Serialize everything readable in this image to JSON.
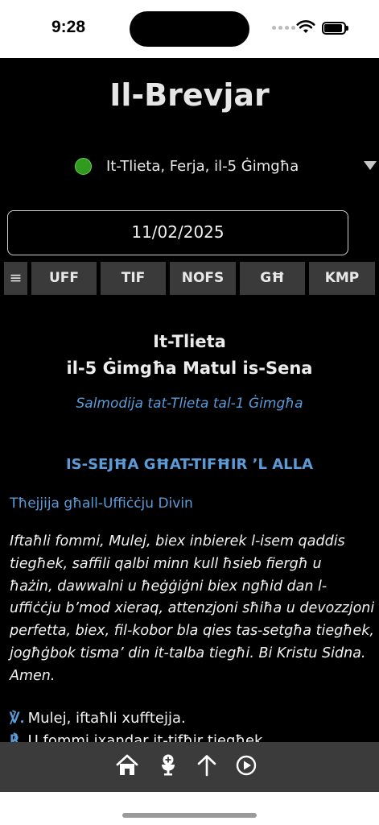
{
  "status_bar": {
    "time": "9:28"
  },
  "app": {
    "title": "Il-Brevjar"
  },
  "day_selector": {
    "label": "It-Tlieta, Ferja, il-5 Ġimgħa",
    "status_color": "#2f9a1e"
  },
  "date_field": {
    "value": "11/02/2025"
  },
  "tabs": [
    {
      "label": "≡"
    },
    {
      "label": "UFF"
    },
    {
      "label": "TIF"
    },
    {
      "label": "NOFS"
    },
    {
      "label": "GĦ"
    },
    {
      "label": "KMP"
    }
  ],
  "content": {
    "day_title_1": "It-Tlieta",
    "day_title_2": "il-5 Ġimgħa Matul is-Sena",
    "psalmody": "Salmodija tat-Tlieta tal-1 Ġimgħa",
    "section_title": "IS-SEJĦA GĦAT-TIFĦIR ’L ALLA",
    "sub_heading": "Tħejjija għall-Uffiċċju Divin",
    "prayer_lines": [
      "Iftaħli fommi, Mulej, biex inbierek l-isem qaddis",
      "tiegħek, saffili qalbi minn kull ħsieb fiergħ u",
      "ħażin, dawwalni u ħeġġiġni biex ngħid dan l-",
      "uffiċċju b’mod xieraq, attenzjoni sħiħa u devozzjoni",
      "perfetta, biex, fil-kobor bla qies tas-setgħa tiegħek,",
      "jogħġbok tisma’ din it-talba tiegħi. Bi Kristu Sidna.",
      "Amen."
    ],
    "versicle_symbol": "℣.",
    "versicle_1": "Mulej, iftaħli xufftejja.",
    "response_symbol": "℟.",
    "response_1": "U fommi ixandar it-tifħir tiegħek."
  },
  "toolbar": {
    "icons": [
      "home-icon",
      "communion-icon",
      "arrow-up-icon",
      "play-icon"
    ]
  },
  "colors": {
    "accent": "#5b9bd8",
    "background": "#000000",
    "tab_bg": "#3a3a3a",
    "toolbar_bg": "#3b3b3b"
  }
}
